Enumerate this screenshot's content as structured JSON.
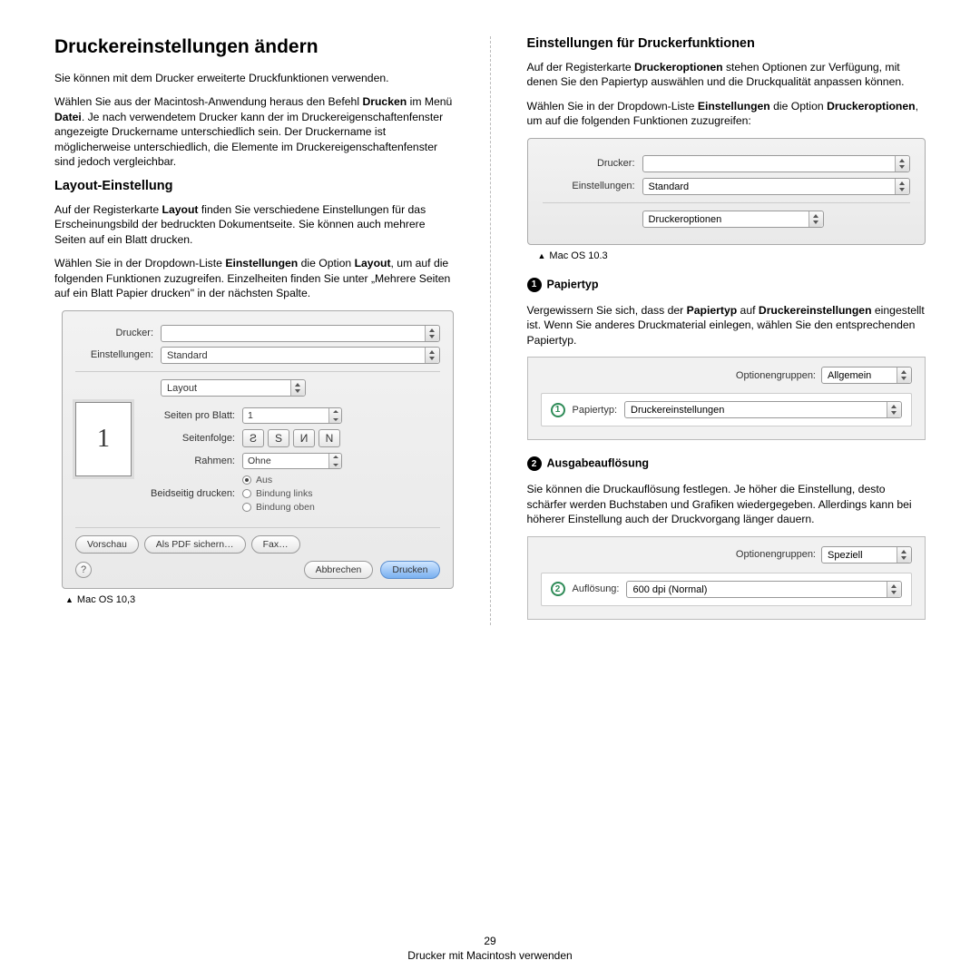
{
  "page_number": "29",
  "footer_text": "Drucker mit Macintosh verwenden",
  "left": {
    "title": "Druckereinstellungen ändern",
    "intro1": "Sie können mit dem Drucker erweiterte Druckfunktionen verwenden.",
    "intro2_pre": "Wählen Sie aus der Macintosh-Anwendung heraus den Befehl ",
    "intro2_b1": "Drucken",
    "intro2_mid": " im Menü ",
    "intro2_b2": "Datei",
    "intro2_post": ". Je nach verwendetem Drucker kann der im Druckereigenschaftenfenster angezeigte Druckername unterschiedlich sein. Der Druckername ist möglicherweise unterschiedlich, die Elemente im Druckereigenschaftenfenster sind jedoch vergleichbar.",
    "sub1": "Layout-Einstellung",
    "p1_pre": "Auf der Registerkarte ",
    "p1_b1": "Layout",
    "p1_post": " finden Sie verschiedene Einstellungen für das Erscheinungsbild der bedruckten Dokumentseite. Sie können auch mehrere Seiten auf ein Blatt drucken.",
    "p2_pre": "Wählen Sie in der Dropdown-Liste ",
    "p2_b1": "Einstellungen",
    "p2_mid": " die Option ",
    "p2_b2": "Layout",
    "p2_post": ", um auf die folgenden Funktionen zuzugreifen. Einzelheiten finden Sie unter „Mehrere Seiten auf ein Blatt Papier drucken\" in der nächsten Spalte.",
    "caption": "Mac OS 10,3",
    "dialog": {
      "drucker_label": "Drucker:",
      "drucker_value": "",
      "einst_label": "Einstellungen:",
      "einst_value": "Standard",
      "layout_value": "Layout",
      "page_num": "1",
      "spb_label": "Seiten pro Blatt:",
      "spb_value": "1",
      "seq_label": "Seitenfolge:",
      "rahmen_label": "Rahmen:",
      "rahmen_value": "Ohne",
      "dup_label": "Beidseitig drucken:",
      "dup_aus": "Aus",
      "dup_links": "Bindung links",
      "dup_oben": "Bindung oben",
      "btn_vorschau": "Vorschau",
      "btn_pdf": "Als PDF sichern…",
      "btn_fax": "Fax…",
      "btn_abbrechen": "Abbrechen",
      "btn_drucken": "Drucken",
      "help": "?"
    }
  },
  "right": {
    "title": "Einstellungen für Druckerfunktionen",
    "p1_pre": "Auf der Registerkarte ",
    "p1_b1": "Druckeroptionen",
    "p1_post": " stehen Optionen zur Verfügung, mit denen Sie den Papiertyp auswählen und die Druckqualität anpassen können.",
    "p2_pre": "Wählen Sie in der Dropdown-Liste ",
    "p2_b1": "Einstellungen",
    "p2_mid": " die Option ",
    "p2_b2": "Druckeroptionen",
    "p2_post": ", um auf die folgenden Funktionen zuzugreifen:",
    "dialog": {
      "drucker_label": "Drucker:",
      "einst_label": "Einstellungen:",
      "einst_value": "Standard",
      "opt_value": "Druckeroptionen"
    },
    "caption": "Mac OS 10.3",
    "sec1_num": "1",
    "sec1_title": "Papiertyp",
    "sec1_p_pre": "Vergewissern Sie sich, dass der ",
    "sec1_p_b1": "Papiertyp",
    "sec1_p_mid": " auf ",
    "sec1_p_b2": "Druckereinstellungen",
    "sec1_p_post": " eingestellt ist. Wenn Sie anderes Druckmaterial einlegen, wählen Sie den entsprechenden Papiertyp.",
    "sec1_box": {
      "group_label": "Optionengruppen:",
      "group_value": "Allgemein",
      "badge": "1",
      "row_label": "Papiertyp:",
      "row_value": "Druckereinstellungen"
    },
    "sec2_num": "2",
    "sec2_title": "Ausgabeauflösung",
    "sec2_p": "Sie können die Druckauflösung festlegen. Je höher die Einstellung, desto schärfer werden Buchstaben und Grafiken wiedergegeben. Allerdings kann bei höherer Einstellung auch der Druckvorgang länger dauern.",
    "sec2_box": {
      "group_label": "Optionengruppen:",
      "group_value": "Speziell",
      "badge": "2",
      "row_label": "Auflösung:",
      "row_value": "600 dpi (Normal)"
    }
  }
}
